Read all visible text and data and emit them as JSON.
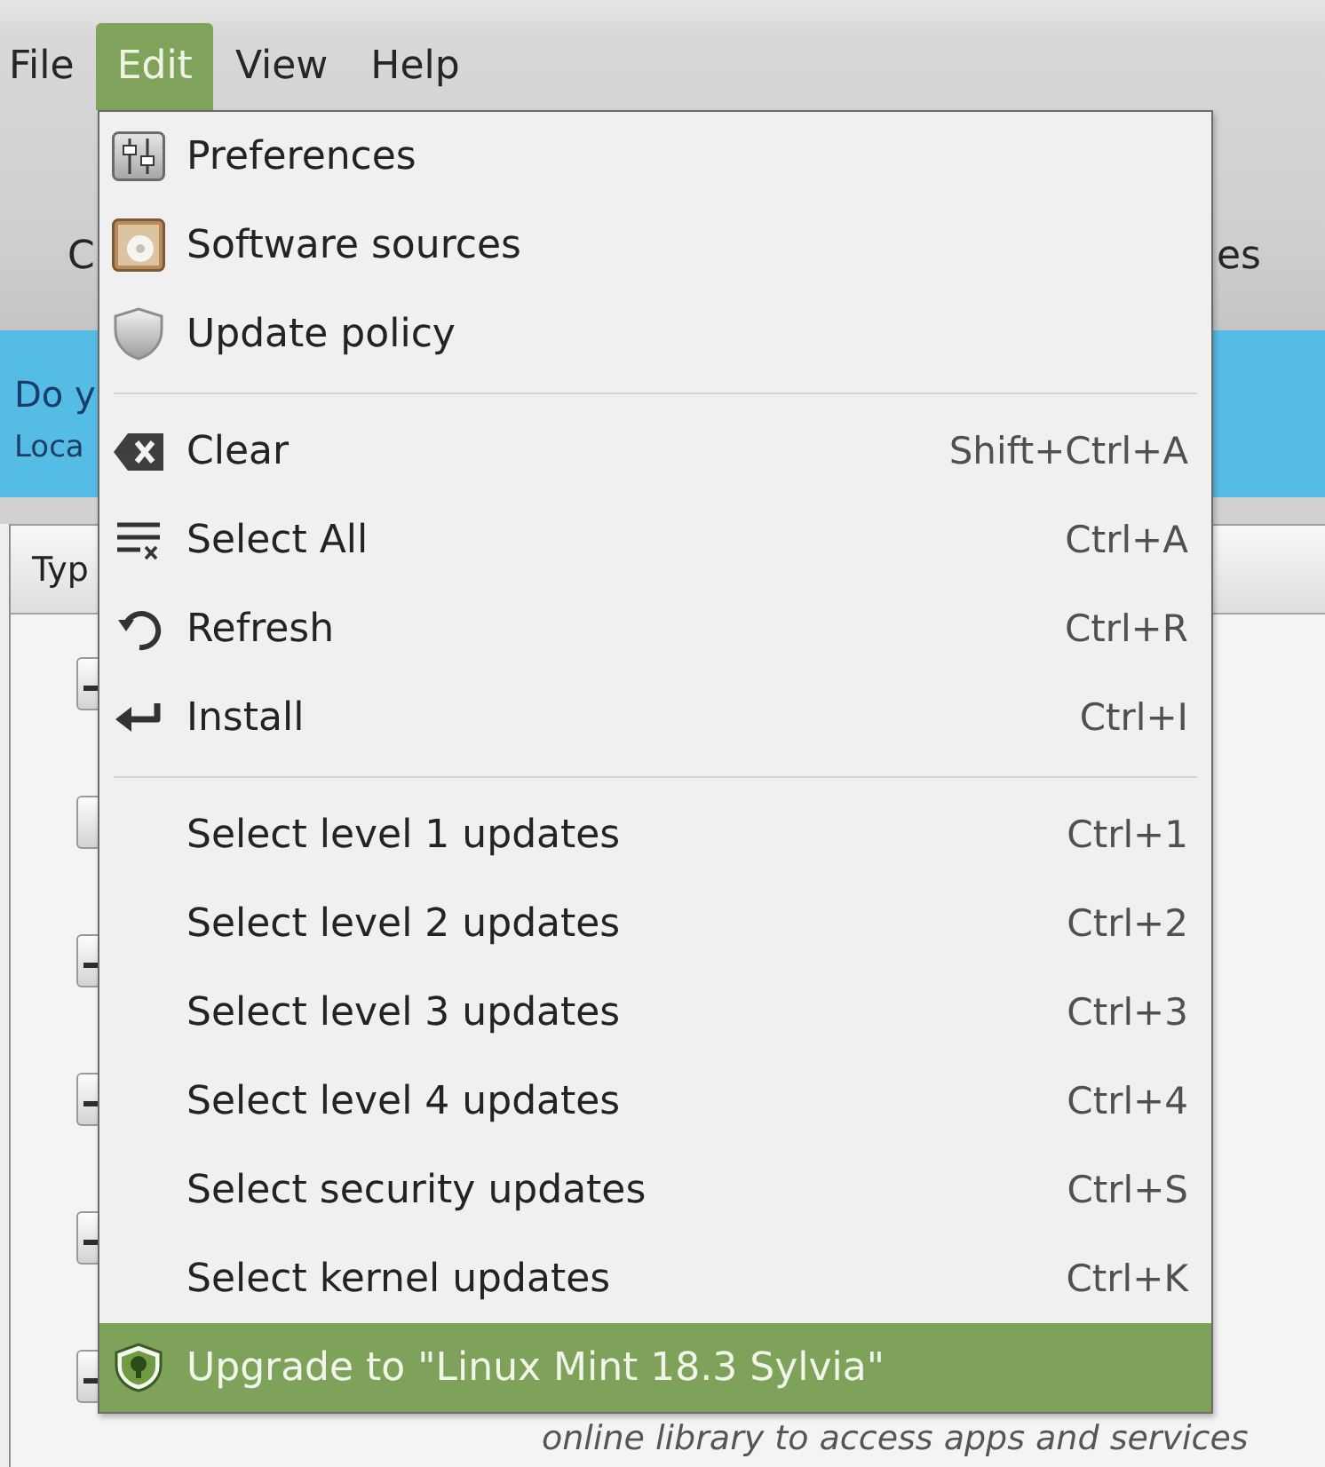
{
  "menu_bar": [
    {
      "label": "File",
      "selected": false
    },
    {
      "label": "Edit",
      "selected": true
    },
    {
      "label": "View",
      "selected": false
    },
    {
      "label": "Help",
      "selected": false
    }
  ],
  "toolbar": {
    "buttons": [
      "C",
      "es"
    ]
  },
  "info_bar": {
    "title": "Do y",
    "subtitle": "Loca"
  },
  "table": {
    "columns": [
      "Typ"
    ],
    "rows": [
      {
        "checked": true
      },
      {
        "checked": false
      },
      {
        "checked": true
      },
      {
        "checked": true
      },
      {
        "checked": true
      },
      {
        "checked": true,
        "description": "online library to access apps and services"
      }
    ]
  },
  "edit_menu": {
    "items": [
      {
        "kind": "item",
        "label": "Preferences",
        "highlighted": false
      },
      {
        "kind": "item",
        "label": "Software sources",
        "highlighted": false
      },
      {
        "kind": "item",
        "label": "Update policy",
        "highlighted": false
      },
      {
        "kind": "separator"
      },
      {
        "kind": "item",
        "label": "Clear",
        "shortcut": "Shift+Ctrl+A",
        "highlighted": false
      },
      {
        "kind": "item",
        "label": "Select All",
        "shortcut": "Ctrl+A",
        "highlighted": false
      },
      {
        "kind": "item",
        "label": "Refresh",
        "shortcut": "Ctrl+R",
        "highlighted": false
      },
      {
        "kind": "item",
        "label": "Install",
        "shortcut": "Ctrl+I",
        "highlighted": false
      },
      {
        "kind": "separator"
      },
      {
        "kind": "item",
        "label": "Select level 1 updates",
        "shortcut": "Ctrl+1",
        "highlighted": false
      },
      {
        "kind": "item",
        "label": "Select level 2 updates",
        "shortcut": "Ctrl+2",
        "highlighted": false
      },
      {
        "kind": "item",
        "label": "Select level 3 updates",
        "shortcut": "Ctrl+3",
        "highlighted": false
      },
      {
        "kind": "item",
        "label": "Select level 4 updates",
        "shortcut": "Ctrl+4",
        "highlighted": false
      },
      {
        "kind": "item",
        "label": "Select security updates",
        "shortcut": "Ctrl+S",
        "highlighted": false
      },
      {
        "kind": "item",
        "label": "Select kernel updates",
        "shortcut": "Ctrl+K",
        "highlighted": false
      },
      {
        "kind": "item",
        "label": "Upgrade to \"Linux Mint 18.3 Sylvia\"",
        "highlighted": true
      }
    ]
  }
}
